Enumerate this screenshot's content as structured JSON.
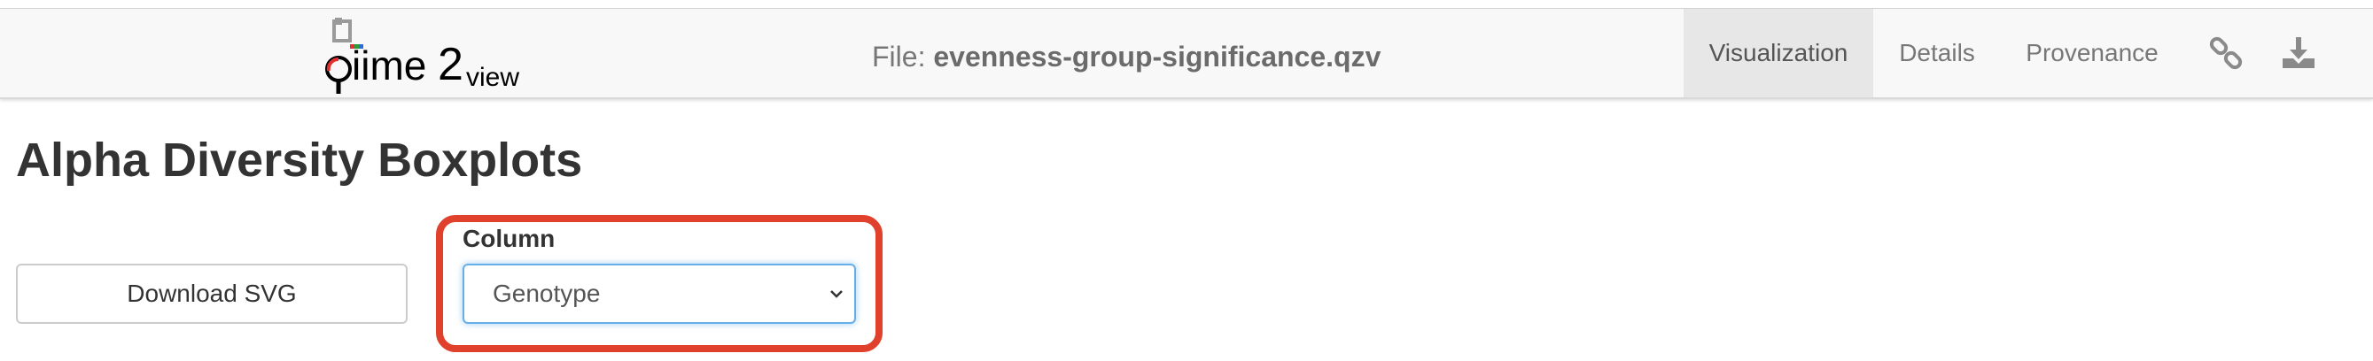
{
  "header": {
    "logo_text": "qiime2view",
    "file_label": "File:",
    "file_name": "evenness-group-significance.qzv",
    "tabs": [
      {
        "label": "Visualization",
        "active": true
      },
      {
        "label": "Details",
        "active": false
      },
      {
        "label": "Provenance",
        "active": false
      }
    ],
    "icons": [
      "link-icon",
      "download-icon"
    ]
  },
  "main": {
    "title": "Alpha Diversity Boxplots",
    "download_button_label": "Download SVG",
    "column_label": "Column",
    "column_select_value": "Genotype"
  },
  "colors": {
    "highlight": "#e0412c",
    "select_focus": "#66afe9",
    "navbar_bg": "#f8f8f8",
    "active_tab_bg": "#e7e7e7"
  }
}
